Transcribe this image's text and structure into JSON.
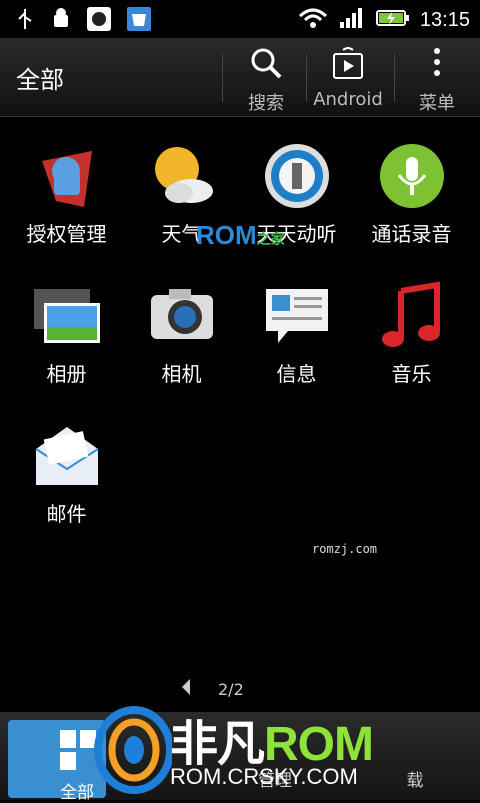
{
  "status": {
    "time": "13:15"
  },
  "titlebar": {
    "title": "全部",
    "search_label": "搜索",
    "android_label": "Android",
    "menu_label": "菜单"
  },
  "apps": [
    {
      "name": "授权管理",
      "icon": "superuser-icon"
    },
    {
      "name": "天气",
      "icon": "weather-icon"
    },
    {
      "name": "天天动听",
      "icon": "ttpod-icon"
    },
    {
      "name": "通话录音",
      "icon": "call-recorder-icon"
    },
    {
      "name": "相册",
      "icon": "gallery-icon"
    },
    {
      "name": "相机",
      "icon": "camera-icon"
    },
    {
      "name": "信息",
      "icon": "messages-icon"
    },
    {
      "name": "音乐",
      "icon": "music-icon"
    },
    {
      "name": "邮件",
      "icon": "mail-icon"
    }
  ],
  "watermark": {
    "main": "ROM",
    "sub": "之家",
    "site": "romzj.com"
  },
  "pager": {
    "text": "2/2"
  },
  "bottombar": {
    "all_label": "全部",
    "item2_label": "管理",
    "item3_label": "载"
  },
  "overlay": {
    "brand": "非凡",
    "rom": "ROM",
    "url": "ROM.CRSKY.COM"
  }
}
